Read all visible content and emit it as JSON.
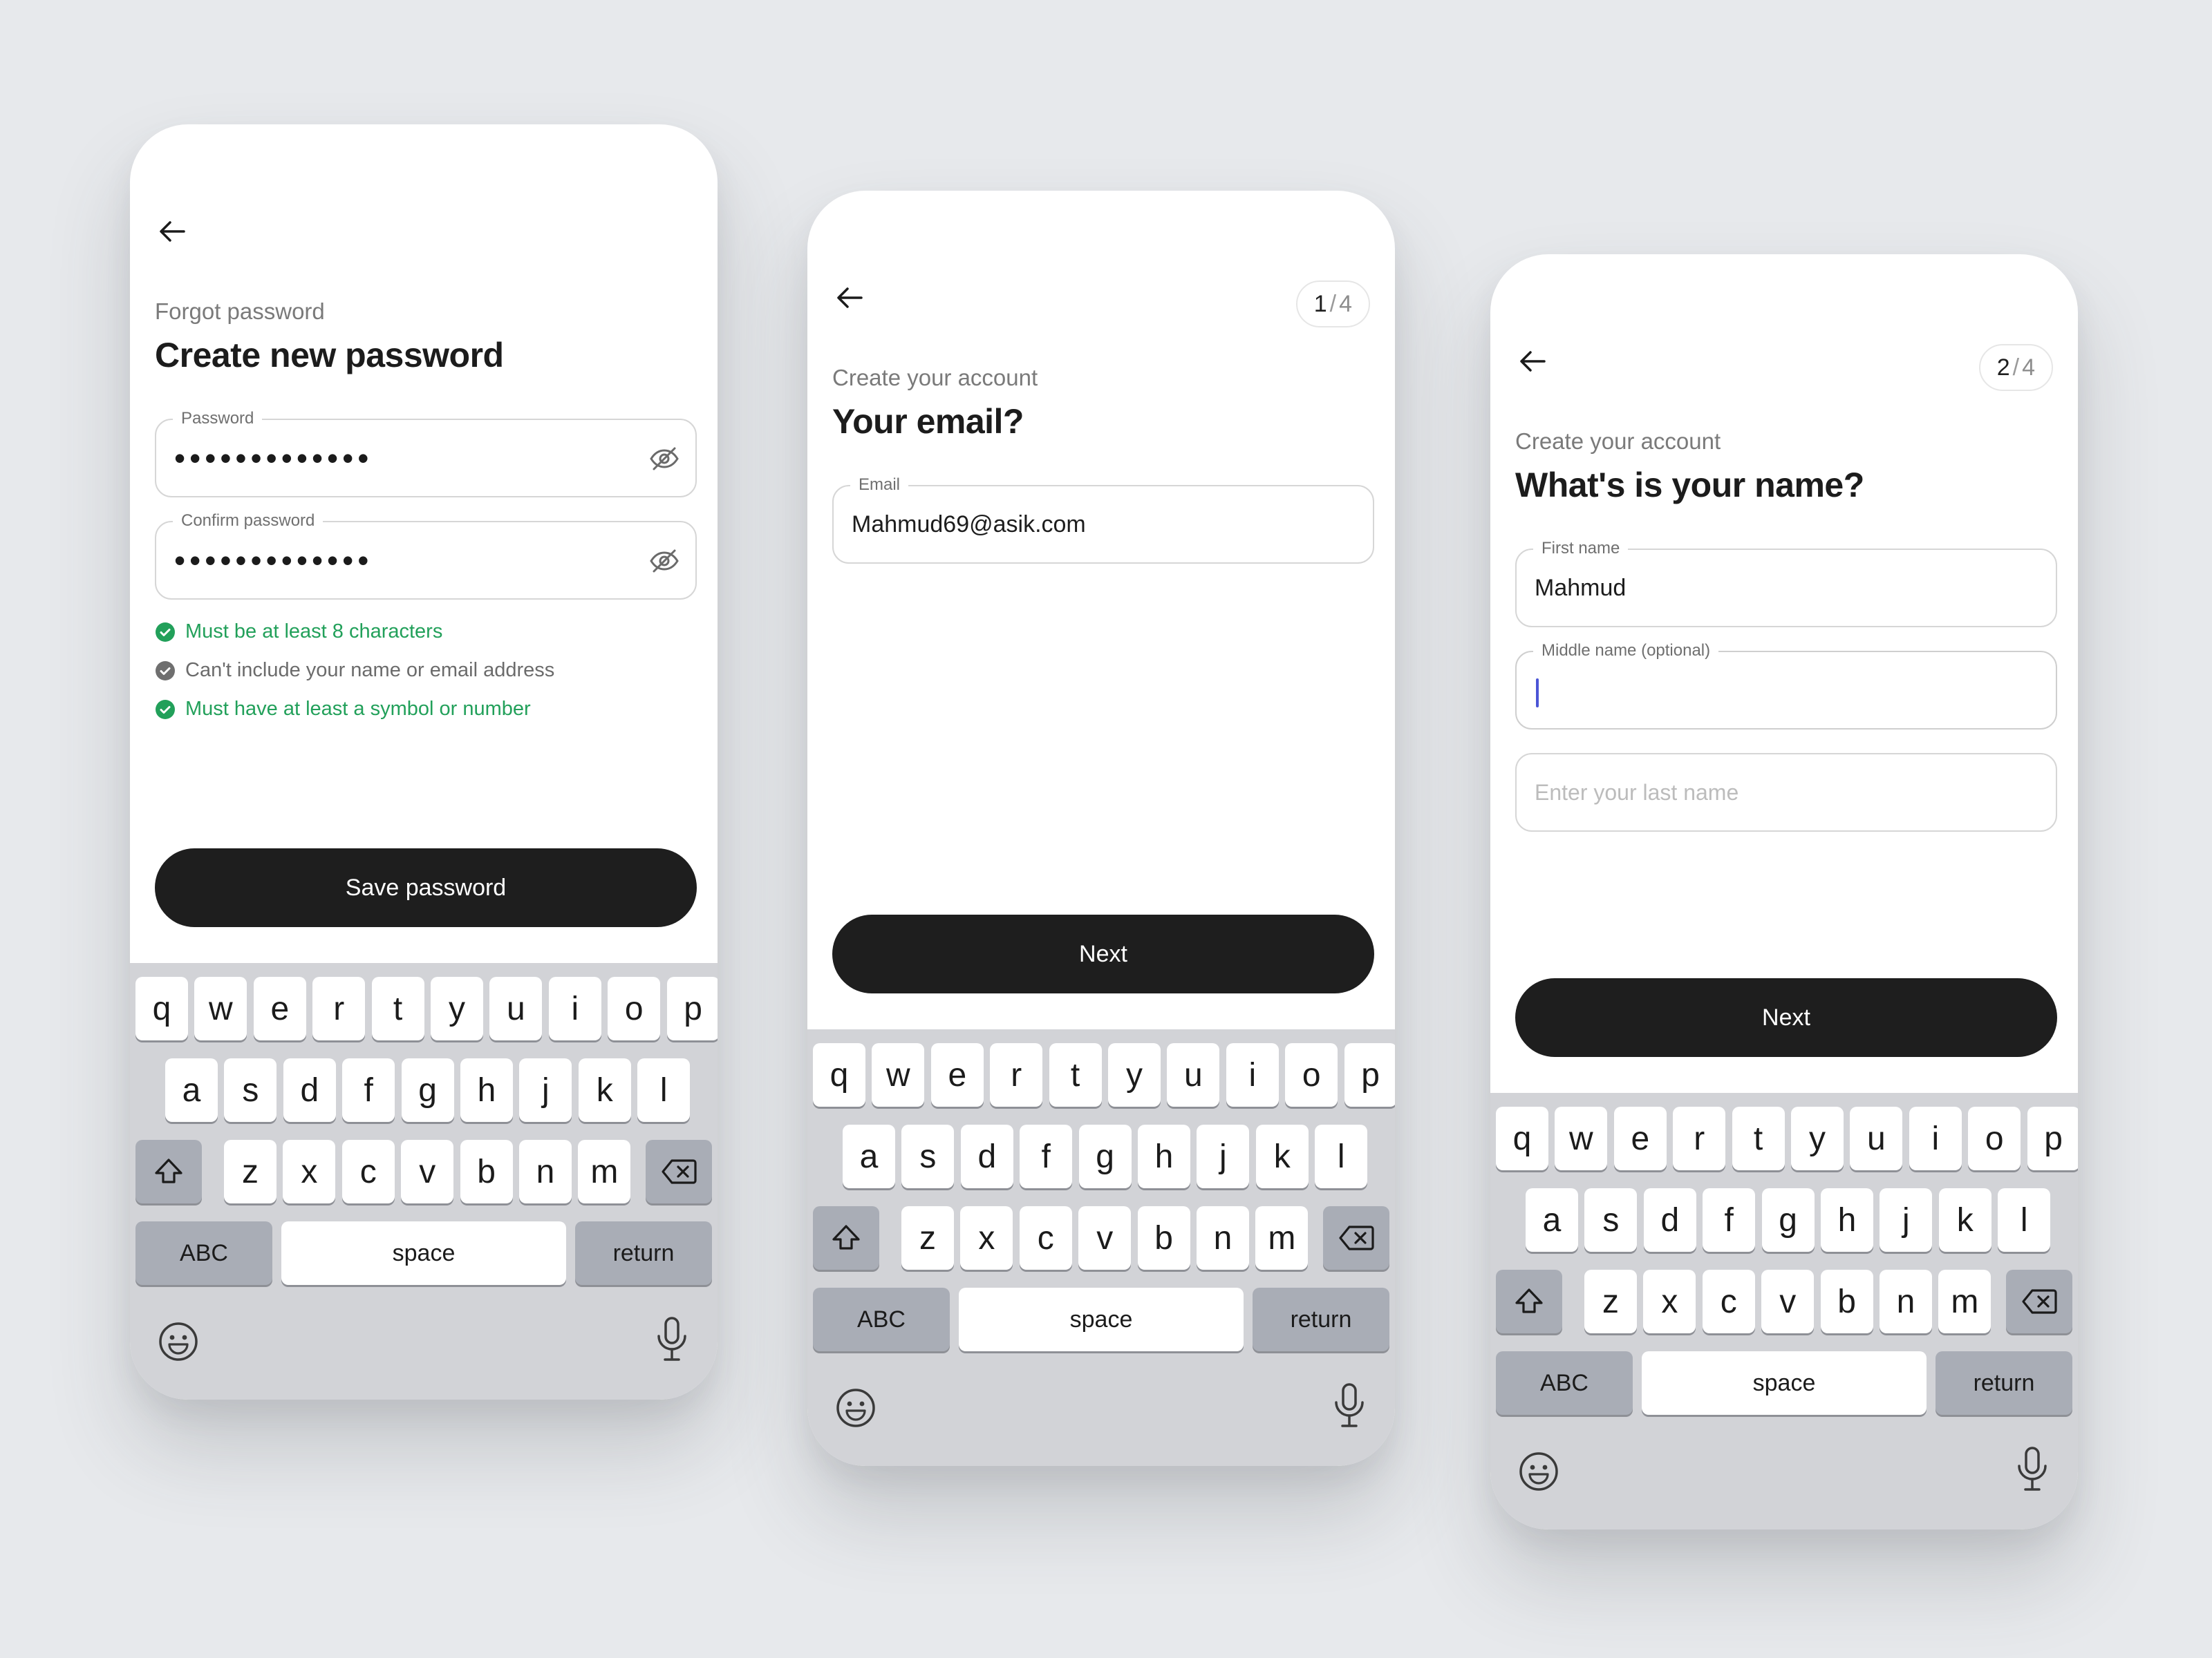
{
  "keyboard": {
    "row1": [
      "q",
      "w",
      "e",
      "r",
      "t",
      "y",
      "u",
      "i",
      "o",
      "p"
    ],
    "row2": [
      "a",
      "s",
      "d",
      "f",
      "g",
      "h",
      "j",
      "k",
      "l"
    ],
    "row3": [
      "z",
      "x",
      "c",
      "v",
      "b",
      "n",
      "m"
    ],
    "abc_label": "ABC",
    "space_label": "space",
    "return_label": "return",
    "shift_icon": "shift-icon",
    "backspace_icon": "backspace-icon",
    "emoji_icon": "emoji-icon",
    "mic_icon": "microphone-icon"
  },
  "screens": [
    {
      "subtitle": "Forgot password",
      "title": "Create new password",
      "fields": [
        {
          "label": "Password",
          "value": "•••••••••••••"
        },
        {
          "label": "Confirm password",
          "value": "•••••••••••••"
        }
      ],
      "rules": [
        {
          "text": "Must be at least 8 characters",
          "status": "met"
        },
        {
          "text": "Can't include your name or email address",
          "status": "unmet"
        },
        {
          "text": "Must have at least a symbol or number",
          "status": "met"
        }
      ],
      "button_label": "Save password"
    },
    {
      "step_current": "1",
      "step_sep": "/",
      "step_total": "4",
      "subtitle": "Create your account",
      "title": "Your email?",
      "fields": [
        {
          "label": "Email",
          "value": "Mahmud69@asik.com"
        }
      ],
      "button_label": "Next"
    },
    {
      "step_current": "2",
      "step_sep": "/",
      "step_total": "4",
      "subtitle": "Create your account",
      "title": "What's is your name?",
      "fields": [
        {
          "label": "First name",
          "value": "Mahmud"
        },
        {
          "label": "Middle name (optional)",
          "value": ""
        },
        {
          "label": "",
          "placeholder": "Enter your last name"
        }
      ],
      "button_label": "Next"
    }
  ],
  "colors": {
    "background": "#e7e9ec",
    "primary_button": "#1e1e1e",
    "success": "#22a05a",
    "muted": "#6b6b6b",
    "caret": "#4b55d6",
    "keyboard": "#d2d3d7"
  }
}
